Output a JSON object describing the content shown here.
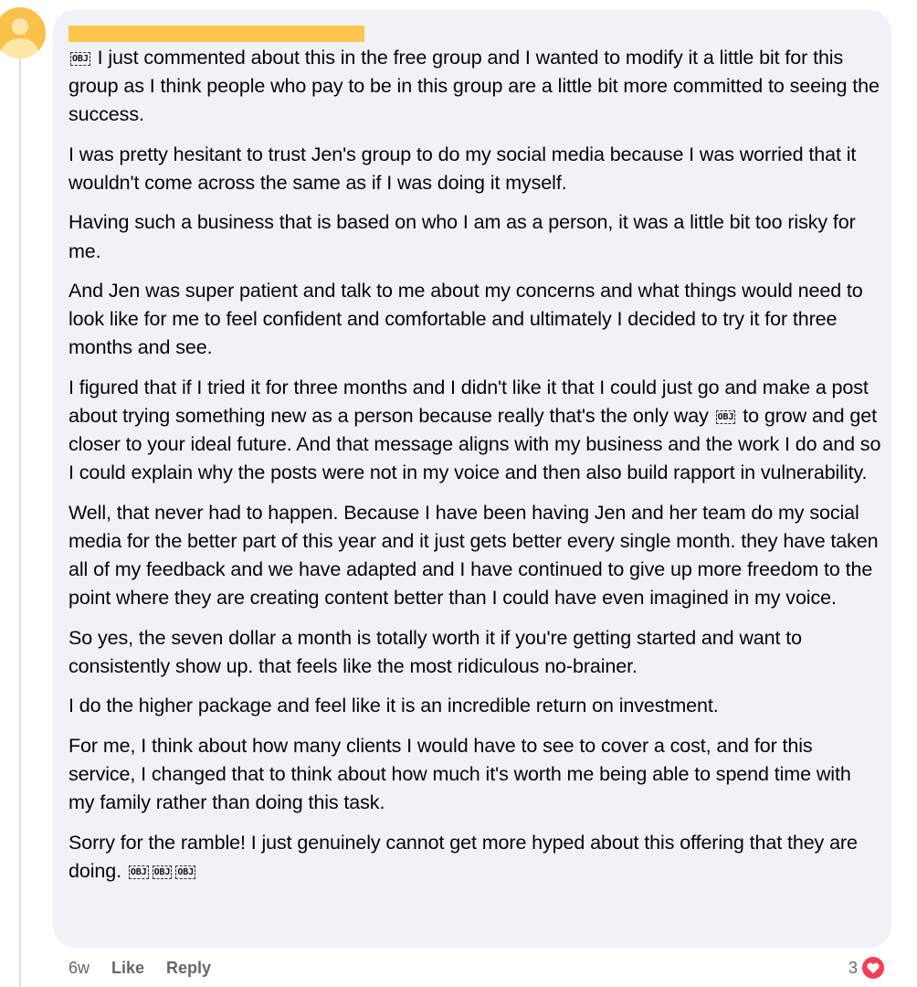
{
  "comment": {
    "paragraphs": [
      [
        {
          "obj": "OBJ"
        },
        " I just commented about this in the free group and I wanted to modify it a little bit for this group as I think people who pay to be in this group are a little bit more committed to seeing the success."
      ],
      [
        "I was pretty hesitant to trust Jen's group to do my social media because I was worried that it wouldn't come across the same as if I was doing it myself."
      ],
      [
        "Having such a business that is based on who I am as a person, it was a little bit too risky for me."
      ],
      [
        "And Jen was super patient and talk to me about my concerns and what things would need to look like for me to feel confident and comfortable and ultimately I decided to try it for three months and see."
      ],
      [
        "I figured that if I tried it for three months and I didn't like it that I could just go and make a post about trying something new as a person because really that's the only way ",
        {
          "obj": "OBJ"
        },
        " to grow and get closer to your ideal future. And that message aligns with my business and the work I do and so I could explain why the posts were not in my voice and then also build rapport in vulnerability."
      ],
      [
        "Well, that never had to happen. Because I have been having Jen and her team do my social media for the better part of this year and it just gets better every single month. they have taken all of my feedback and we have adapted and I have continued to give up more freedom to the point where they are creating content better than I could have even imagined in my voice."
      ],
      [
        "So yes, the seven dollar a month is totally worth it if you're getting started and want to consistently show up. that feels like the most ridiculous no-brainer."
      ],
      [
        "I do the higher package and feel like it is an incredible return on investment."
      ],
      [
        "For me, I think about how many clients I would have to see to cover a cost, and for this service, I changed that to think about how much it's worth me being able to spend time with my family rather than doing this task."
      ],
      [
        "Sorry for the ramble! I just genuinely cannot get more hyped about this offering that they are doing. ",
        {
          "obj": "OBJ"
        },
        {
          "obj": "OBJ"
        },
        {
          "obj": "OBJ"
        }
      ]
    ]
  },
  "actions": {
    "age": "6w",
    "like_label": "Like",
    "reply_label": "Reply"
  },
  "reactions": {
    "count": "3",
    "icon": "heart-icon",
    "color": "#f33e58"
  }
}
